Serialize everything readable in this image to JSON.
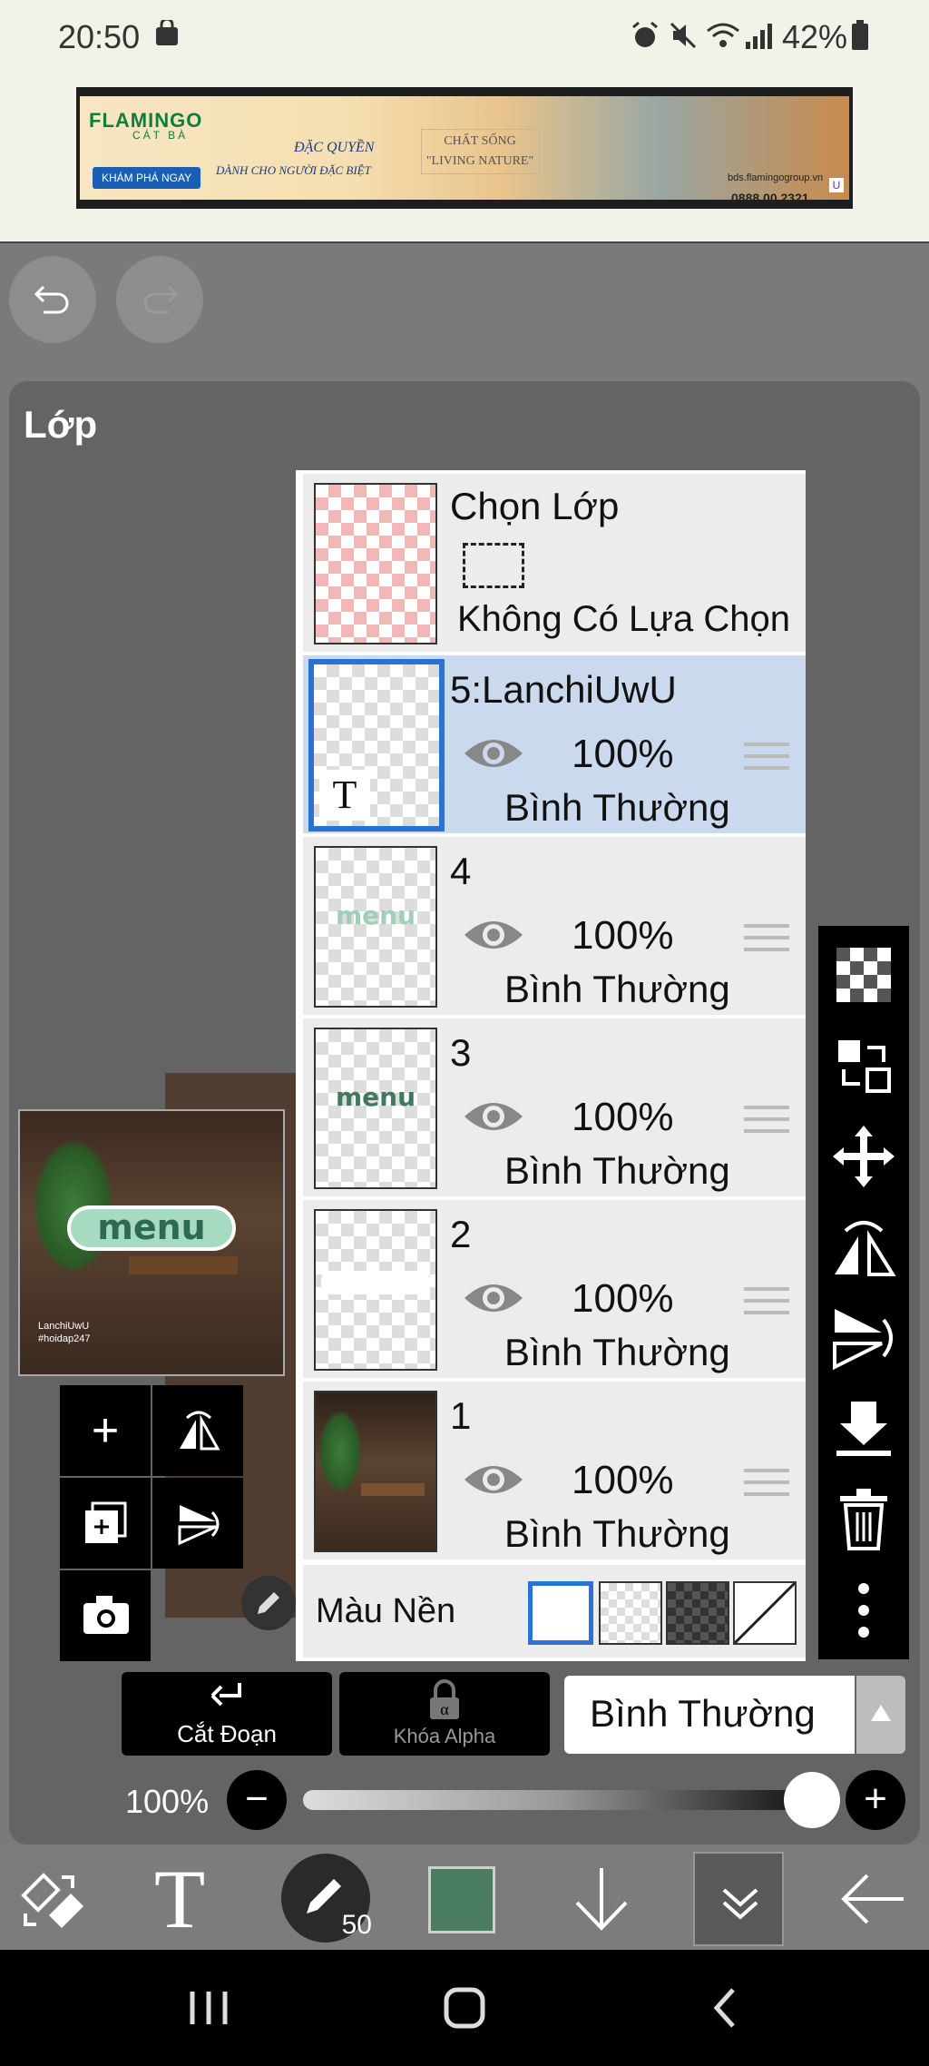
{
  "status_bar": {
    "time": "20:50",
    "battery": "42%"
  },
  "ad": {
    "logo": "FLAMINGO",
    "logo_sub": "CÁT BÀ",
    "cta": "KHÁM PHÁ NGAY",
    "line1": "ĐẶC QUYỀN",
    "line2": "DÀNH CHO NGƯỜI ĐẶC BIỆT",
    "line3": "CHẤT SỐNG \"LIVING NATURE\"",
    "site": "bds.flamingogroup.vn",
    "phone": "0888.00.2321"
  },
  "panel": {
    "title": "Lớp"
  },
  "preview": {
    "word": "menu",
    "credit1": "LanchiUwU",
    "credit2": "#hoidap247"
  },
  "selection": {
    "title": "Chọn Lớp",
    "none": "Không Có Lựa Chọn"
  },
  "layers": [
    {
      "name": "5:LanchiUwU",
      "opacity": "100%",
      "blend": "Bình Thường",
      "selected": true,
      "type_mark": "T"
    },
    {
      "name": "4",
      "opacity": "100%",
      "blend": "Bình Thường",
      "thumb_word": "menu"
    },
    {
      "name": "3",
      "opacity": "100%",
      "blend": "Bình Thường",
      "thumb_word": "menu"
    },
    {
      "name": "2",
      "opacity": "100%",
      "blend": "Bình Thường"
    },
    {
      "name": "1",
      "opacity": "100%",
      "blend": "Bình Thường"
    }
  ],
  "background": {
    "label": "Màu Nền"
  },
  "actions": {
    "clip": "Cắt Đoạn",
    "alpha_lock": "Khóa Alpha",
    "blend_mode": "Bình Thường"
  },
  "opacity_control": {
    "value_text": "100%",
    "value": 1.0
  },
  "toolbar": {
    "brush_size": "50",
    "text_tool": "T",
    "color": "#4a7c62"
  },
  "colors": {
    "accent": "#2c72d3",
    "selected_row": "#cbd9ee",
    "panel": "#646464"
  }
}
